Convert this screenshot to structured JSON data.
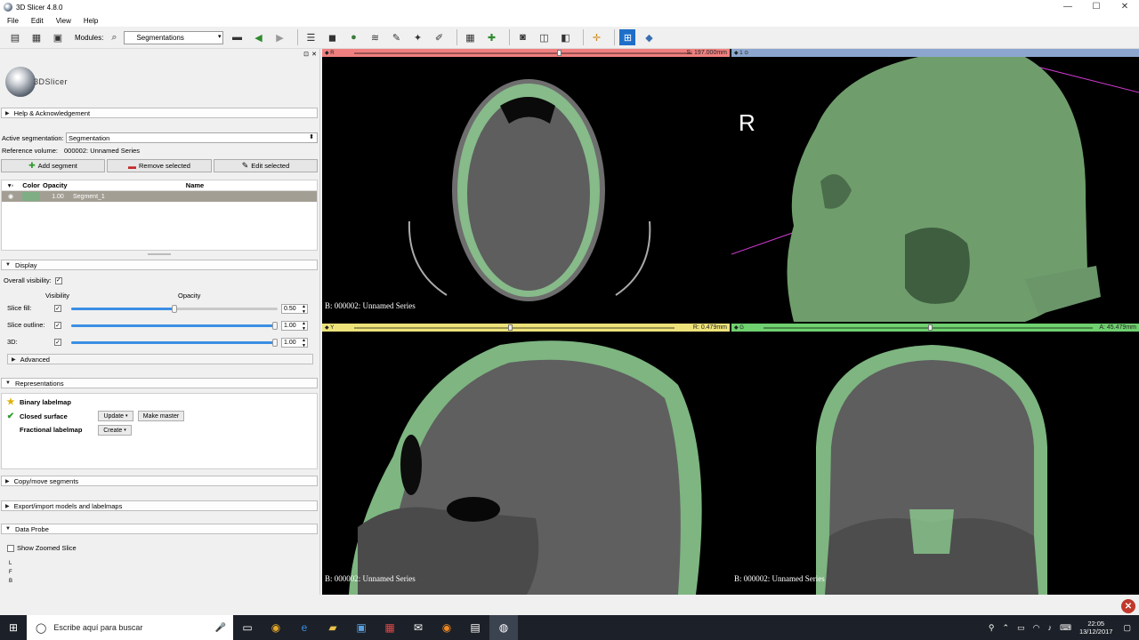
{
  "app": {
    "title": "3D Slicer 4.8.0"
  },
  "window_controls": {
    "minimize": "—",
    "maximize": "☐",
    "close": "✕"
  },
  "menu": [
    "File",
    "Edit",
    "View",
    "Help"
  ],
  "toolbar": {
    "modules_label": "Modules:",
    "module_selected": "Segmentations"
  },
  "logo": {
    "text": "3DSlicer"
  },
  "sections": {
    "help": "Help & Acknowledgement",
    "display": "Display",
    "advanced": "Advanced",
    "representations": "Representations",
    "copy_move": "Copy/move segments",
    "export_import": "Export/import models and labelmaps",
    "data_probe": "Data Probe"
  },
  "segmentation": {
    "active_label": "Active segmentation:",
    "active_value": "Segmentation",
    "reference_label": "Reference volume:",
    "reference_value": "000002: Unnamed Series",
    "add_segment": "Add segment",
    "remove_selected": "Remove selected",
    "edit_selected": "Edit selected"
  },
  "segment_table": {
    "headers": {
      "color": "Color",
      "opacity": "Opacity",
      "name": "Name"
    },
    "rows": [
      {
        "opacity": "1.00",
        "name": "Segment_1",
        "color": "#7fae85"
      }
    ]
  },
  "display": {
    "overall_visibility_label": "Overall visibility:",
    "visibility_header": "Visibility",
    "opacity_header": "Opacity",
    "rows": [
      {
        "label": "Slice fill:",
        "value": "0.50",
        "level": 0.5
      },
      {
        "label": "Slice outline:",
        "value": "1.00",
        "level": 1.0
      },
      {
        "label": "3D:",
        "value": "1.00",
        "level": 1.0
      }
    ]
  },
  "representations": {
    "items": [
      {
        "name": "Binary labelmap",
        "icon": "star-icon"
      },
      {
        "name": "Closed surface",
        "icon": "check-icon"
      },
      {
        "name": "Fractional labelmap",
        "icon": ""
      }
    ],
    "update": "Update",
    "make_master": "Make master",
    "create": "Create"
  },
  "data_probe": {
    "show_zoomed": "Show Zoomed Slice",
    "l": "L",
    "f": "F",
    "b": "B"
  },
  "views": {
    "red": {
      "letter": "R",
      "coord": "S: 197.000mm",
      "label": "B: 000002: Unnamed Series",
      "color": "#f08080",
      "slider": 0.6
    },
    "threed": {
      "letter": "1",
      "orientation": "R",
      "color": "#8da6cf"
    },
    "yellow": {
      "letter": "Y",
      "coord": "R: 0.479mm",
      "label": "B: 000002: Unnamed Series",
      "color": "#ede37a",
      "slider": 0.48
    },
    "green": {
      "letter": "G",
      "coord": "A: 45.479mm",
      "label": "B: 000002: Unnamed Series",
      "color": "#6fd16f",
      "slider": 0.5
    }
  },
  "segment_color": "#8cc98f",
  "taskbar": {
    "search_placeholder": "Escribe aquí para buscar",
    "time": "22:05",
    "date": "13/12/2017"
  }
}
